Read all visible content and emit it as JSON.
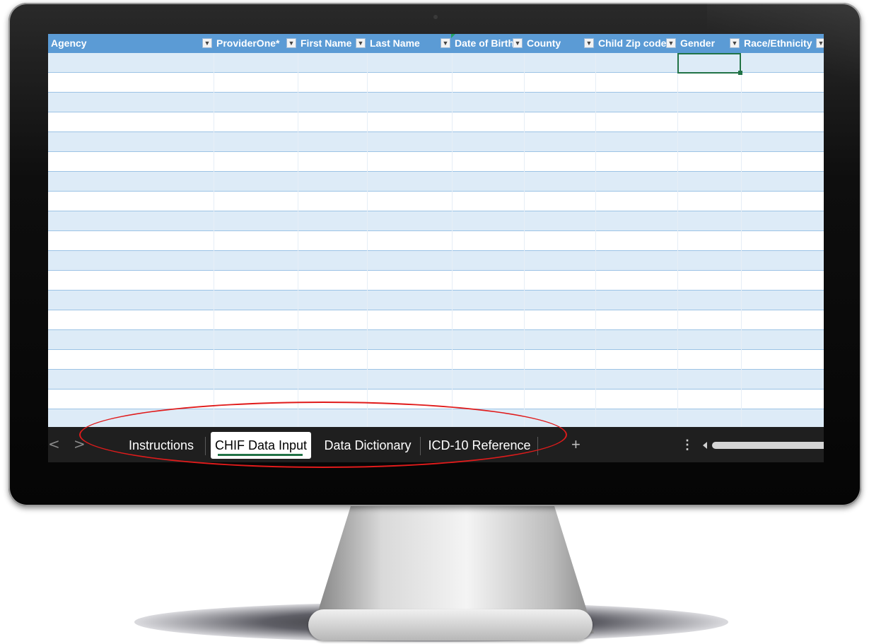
{
  "spreadsheet": {
    "columns": [
      {
        "label": "Agency"
      },
      {
        "label": "ProviderOne*"
      },
      {
        "label": "First Name"
      },
      {
        "label": "Last Name"
      },
      {
        "label": "Date of Birth"
      },
      {
        "label": "County"
      },
      {
        "label": "Child Zip code"
      },
      {
        "label": "Gender"
      },
      {
        "label": "Race/Ethnicity"
      }
    ],
    "filter_icon": "filter-dropdown-arrow",
    "table_style_colors": {
      "header": "#5b9bd5",
      "band": "#ddebf7",
      "selection": "#217346"
    }
  },
  "sheet_tabs": {
    "tabs": [
      {
        "label": "Instructions",
        "active": false
      },
      {
        "label": "CHIF Data Input",
        "active": true
      },
      {
        "label": "Data Dictionary",
        "active": false
      },
      {
        "label": "ICD-10 Reference",
        "active": false
      }
    ],
    "prev_icon": "<",
    "next_icon": ">",
    "add_icon": "+",
    "more_icon": "⋮"
  },
  "annotation": {
    "highlight_color": "#e01b1b"
  }
}
